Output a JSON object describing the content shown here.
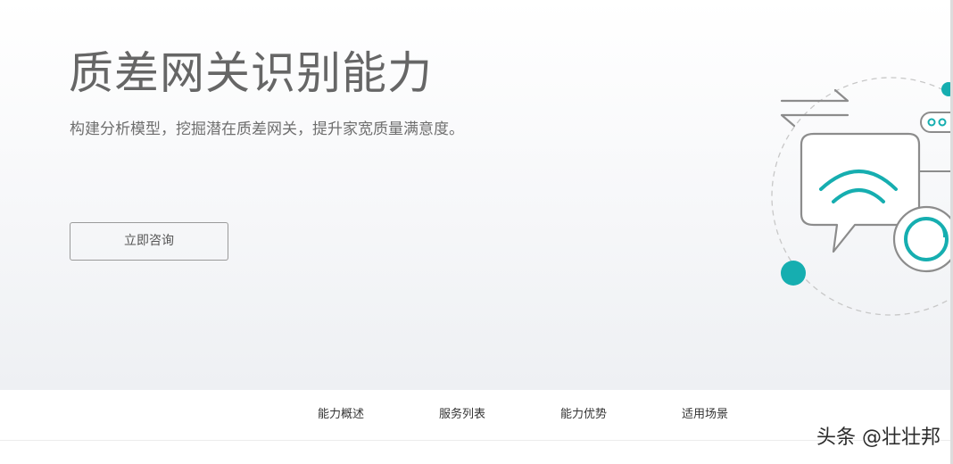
{
  "hero": {
    "title": "质差网关识别能力",
    "subtitle": "构建分析模型，挖掘潜在质差网关，提升家宽质量满意度。",
    "consult_button": "立即咨询"
  },
  "subnav": {
    "items": [
      {
        "label": "能力概述"
      },
      {
        "label": "服务列表"
      },
      {
        "label": "能力优势"
      },
      {
        "label": "适用场景"
      }
    ]
  },
  "watermark": "头条 @壮壮邦",
  "colors": {
    "accent": "#16aeb0",
    "title": "#666666",
    "line_art": "#8c8c8c"
  },
  "icons": [
    "exchange-arrows-icon",
    "chat-bubble-icon",
    "wifi-icon",
    "magnifier-icon",
    "toggle-icon"
  ]
}
